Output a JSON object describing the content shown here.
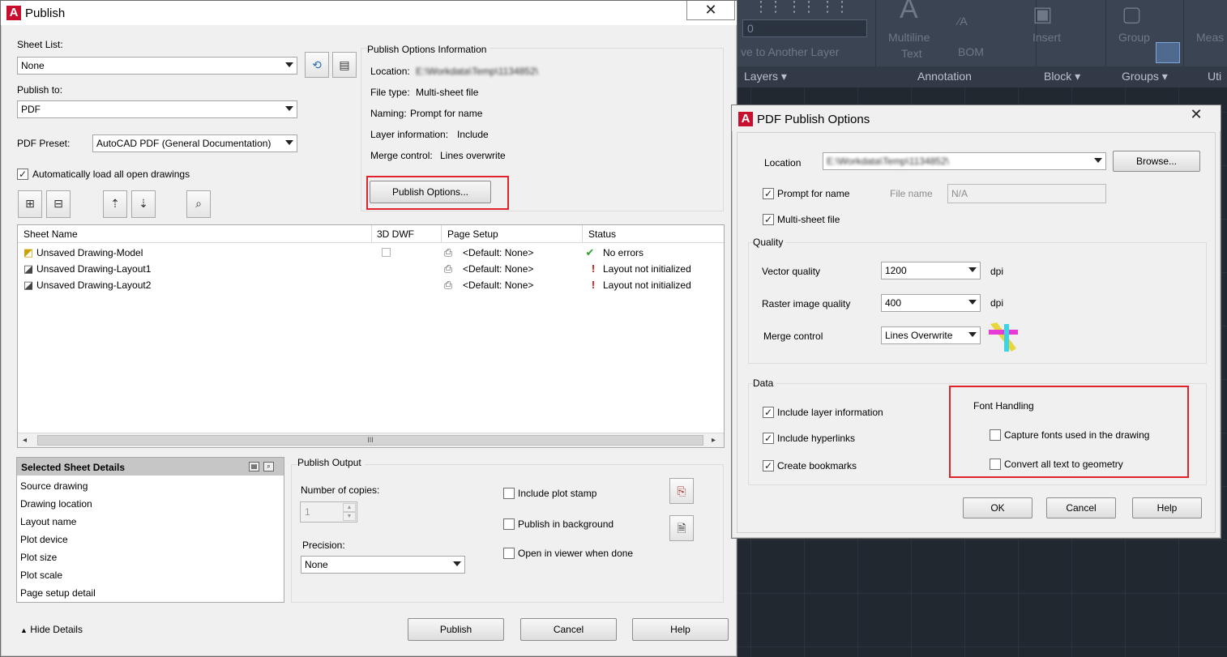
{
  "ribbon": {
    "combo_value": "0",
    "move_layer_text": "ve to Another Layer",
    "multiline_text_line1": "Multiline",
    "multiline_text_line2": "Text",
    "bom": "BOM",
    "insert": "Insert",
    "group": "Group",
    "measure": "Meas",
    "panels": [
      "Layers",
      "Annotation",
      "Block",
      "Groups",
      "Uti"
    ]
  },
  "publish": {
    "title": "Publish",
    "close": "✕",
    "sheet_list_label": "Sheet List:",
    "sheet_list_value": "None",
    "publish_to_label": "Publish to:",
    "publish_to_value": "PDF",
    "pdf_preset_label": "PDF Preset:",
    "pdf_preset_value": "AutoCAD PDF (General Documentation)",
    "auto_load_label": "Automatically load all open drawings",
    "auto_load_checked": true,
    "options_info_title": "Publish Options Information",
    "options_info": {
      "location_label": "Location:",
      "location_value": "E:\\Workdata\\Temp\\1134852\\",
      "filetype_label": "File type:",
      "filetype_value": "Multi-sheet file",
      "naming_label": "Naming:",
      "naming_value": "Prompt for name",
      "layer_label": "Layer information:",
      "layer_value": "Include",
      "merge_label": "Merge control:",
      "merge_value": "Lines overwrite"
    },
    "publish_options_button": "Publish Options...",
    "table_headers": [
      "Sheet Name",
      "3D DWF",
      "Page Setup",
      "Status"
    ],
    "rows": [
      {
        "name": "Unsaved Drawing-Model",
        "page_setup": "<Default: None>",
        "status": "No errors",
        "status_ok": true
      },
      {
        "name": "Unsaved Drawing-Layout1",
        "page_setup": "<Default: None>",
        "status": "Layout not initialized",
        "status_ok": false
      },
      {
        "name": "Unsaved Drawing-Layout2",
        "page_setup": "<Default: None>",
        "status": "Layout not initialized",
        "status_ok": false
      }
    ],
    "scroll_grip": "III",
    "selected_details_title": "Selected Sheet Details",
    "details": [
      "Source drawing",
      "Drawing location",
      "Layout name",
      "Plot device",
      "Plot size",
      "Plot scale",
      "Page setup detail"
    ],
    "publish_output_title": "Publish Output",
    "copies_label": "Number of copies:",
    "copies_value": "1",
    "precision_label": "Precision:",
    "precision_value": "None",
    "include_plot_stamp": "Include plot stamp",
    "publish_in_background": "Publish in background",
    "open_in_viewer": "Open in viewer when done",
    "hide_details": "Hide Details",
    "publish_button": "Publish",
    "cancel_button": "Cancel",
    "help_button": "Help"
  },
  "pdf_options": {
    "title": "PDF Publish Options",
    "close": "✕",
    "location_label": "Location",
    "location_value": "E:\\Workdata\\Temp\\1134852\\",
    "browse_button": "Browse...",
    "prompt_for_name": "Prompt for name",
    "prompt_checked": true,
    "file_name_label": "File name",
    "file_name_value": "N/A",
    "multi_sheet": "Multi-sheet file",
    "multi_sheet_checked": true,
    "quality_title": "Quality",
    "vector_quality_label": "Vector quality",
    "vector_quality_value": "1200",
    "raster_quality_label": "Raster image quality",
    "raster_quality_value": "400",
    "dpi": "dpi",
    "merge_control_label": "Merge control",
    "merge_control_value": "Lines Overwrite",
    "data_title": "Data",
    "include_layer_info": "Include layer information",
    "include_hyperlinks": "Include hyperlinks",
    "create_bookmarks": "Create bookmarks",
    "font_handling_title": "Font Handling",
    "capture_fonts": "Capture fonts used in the drawing",
    "convert_text": "Convert all text to geometry",
    "ok_button": "OK",
    "cancel_button": "Cancel",
    "help_button": "Help"
  },
  "colors": {
    "highlight_box": "#e0232b",
    "autocad_red": "#c8102e",
    "ribbon_bg": "#3b4453",
    "canvas_bg": "#212830"
  }
}
